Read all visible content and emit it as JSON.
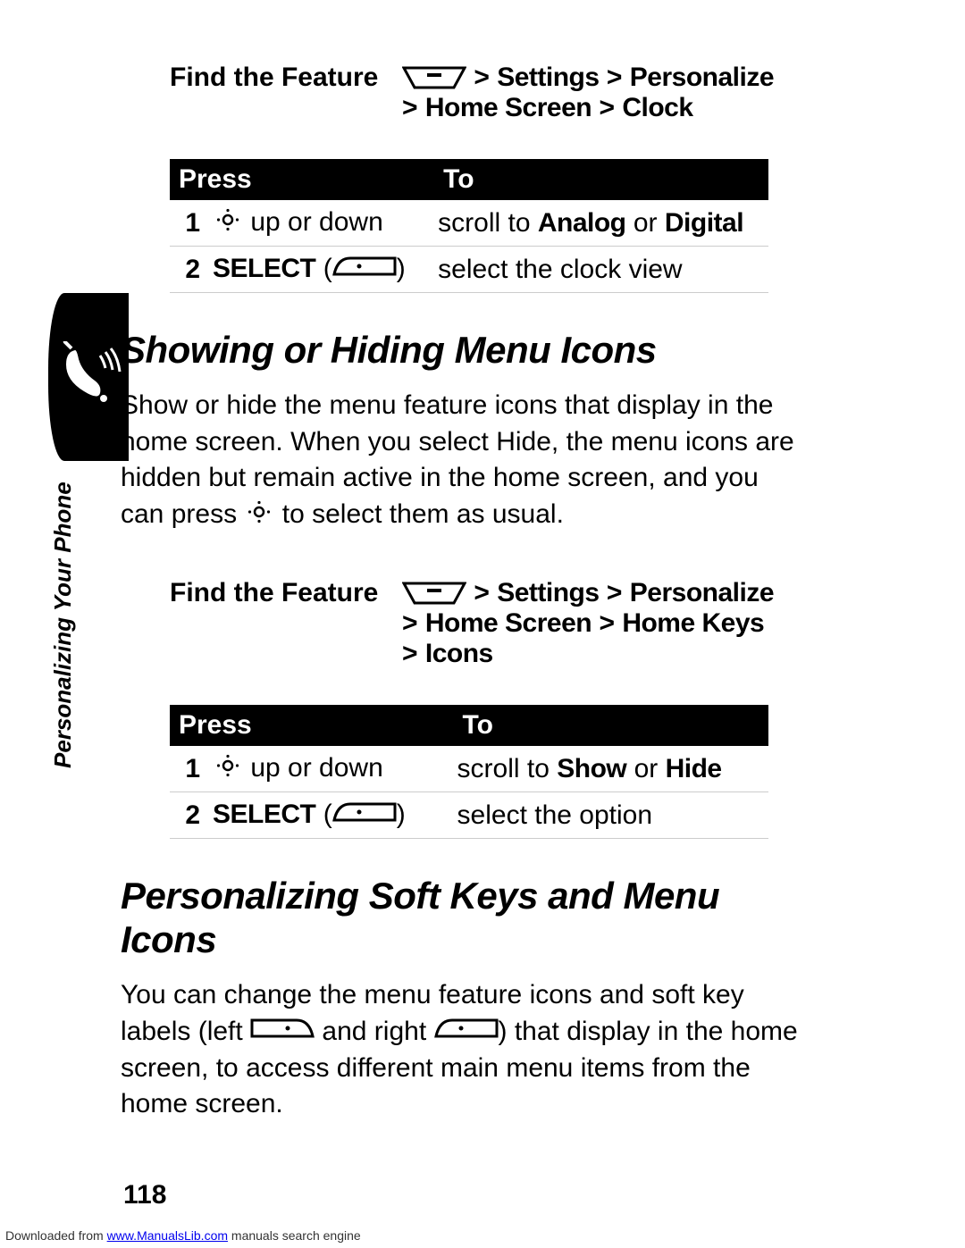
{
  "sideLabel": "Personalizing Your Phone",
  "pageNumber": "118",
  "footer": {
    "prefix": "Downloaded from ",
    "link": "www.ManualsLib.com",
    "suffix": " manuals search engine"
  },
  "find1": {
    "label": "Find the Feature",
    "line1_gt1": "> ",
    "line1_s": "Settings",
    "line1_gt2": " > ",
    "line1_p": "Personalize",
    "line2_gt1": "> ",
    "line2_hs": "Home Screen",
    "line2_gt2": " > ",
    "line2_c": "Clock"
  },
  "table1": {
    "pressHeader": "Press",
    "toHeader": "To",
    "r1": {
      "n": "1",
      "press_text": " up or down",
      "to_prefix": "scroll to ",
      "to_a": "Analog",
      "to_mid": " or ",
      "to_d": "Digital"
    },
    "r2": {
      "n": "2",
      "press_select": "SELECT",
      "press_open": " (",
      "press_close": ")",
      "to": "select the clock view"
    }
  },
  "section2": {
    "title": "Showing or Hiding Menu Icons",
    "body_p1_a": "Show or hide the menu feature icons that display in the home screen. When you select Hide, the menu icons are hidden but remain active in the home screen, and you can press ",
    "body_p1_b": " to select them as usual."
  },
  "find2": {
    "label": "Find the Feature",
    "line1_gt1": "> ",
    "line1_s": "Settings",
    "line1_gt2": " > ",
    "line1_p": "Personalize",
    "line2_gt1": "> ",
    "line2_hs": "Home Screen",
    "line2_gt2": " > ",
    "line2_hk": "Home Keys",
    "line3_gt1": "> ",
    "line3_i": "Icons"
  },
  "table2": {
    "pressHeader": "Press",
    "toHeader": "To",
    "r1": {
      "n": "1",
      "press_text": " up or down",
      "to_prefix": "scroll to ",
      "to_a": "Show",
      "to_mid": " or ",
      "to_d": "Hide"
    },
    "r2": {
      "n": "2",
      "press_select": "SELECT",
      "press_open": " (",
      "press_close": ")",
      "to": "select the option"
    }
  },
  "section3": {
    "title": "Personalizing Soft Keys and Menu Icons",
    "body_a": "You can change the menu feature icons and soft key labels (left ",
    "body_b": " and right ",
    "body_c": ") that display in the home screen, to access different main menu items from the home screen."
  }
}
